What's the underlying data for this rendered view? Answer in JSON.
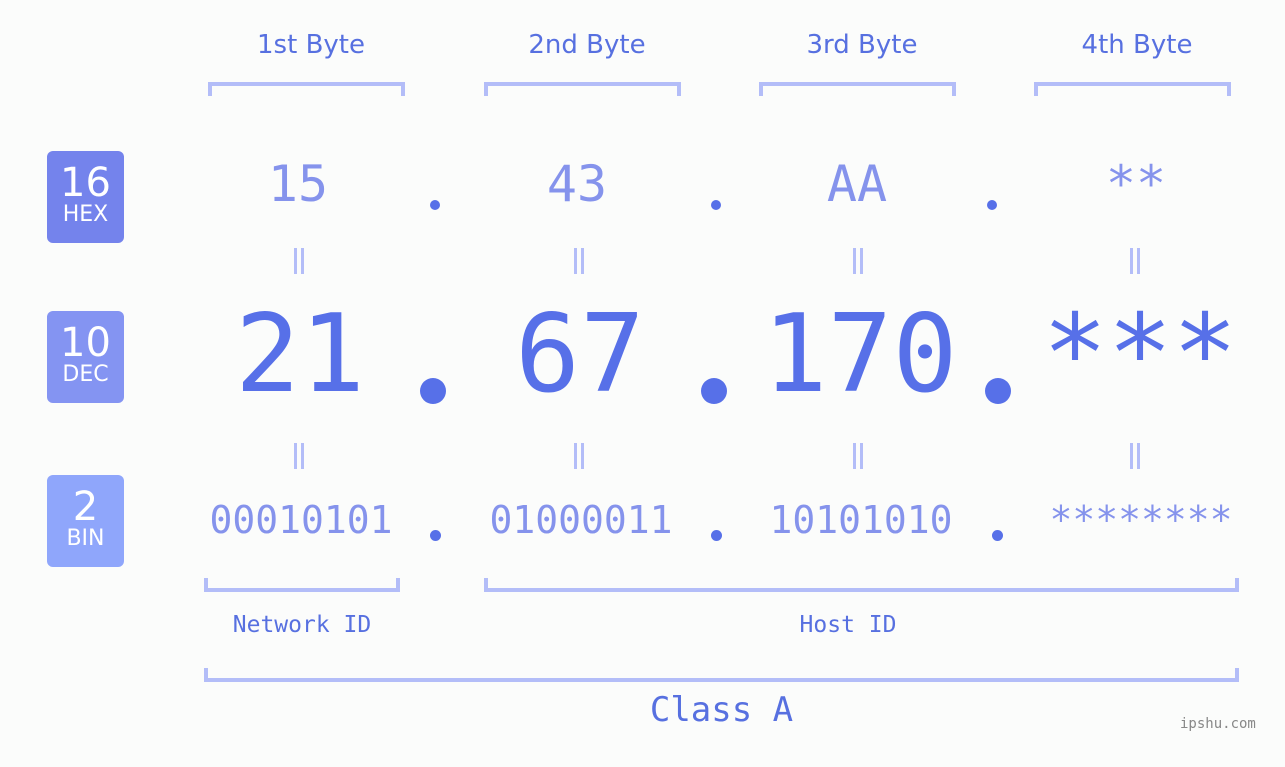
{
  "bytes": [
    {
      "title": "1st Byte",
      "hex": "15",
      "dec": "21",
      "bin": "00010101"
    },
    {
      "title": "2nd Byte",
      "hex": "43",
      "dec": "67",
      "bin": "01000011"
    },
    {
      "title": "3rd Byte",
      "hex": "AA",
      "dec": "170",
      "bin": "10101010"
    },
    {
      "title": "4th Byte",
      "hex": "**",
      "dec": "***",
      "bin": "********"
    }
  ],
  "badges": {
    "hex": {
      "num": "16",
      "label": "HEX",
      "color": "#7483ec"
    },
    "dec": {
      "num": "10",
      "label": "DEC",
      "color": "#8494f2"
    },
    "bin": {
      "num": "2",
      "label": "BIN",
      "color": "#8fa6fb"
    }
  },
  "labels": {
    "network_id": "Network ID",
    "host_id": "Host ID",
    "class": "Class A"
  },
  "watermark": "ipshu.com"
}
